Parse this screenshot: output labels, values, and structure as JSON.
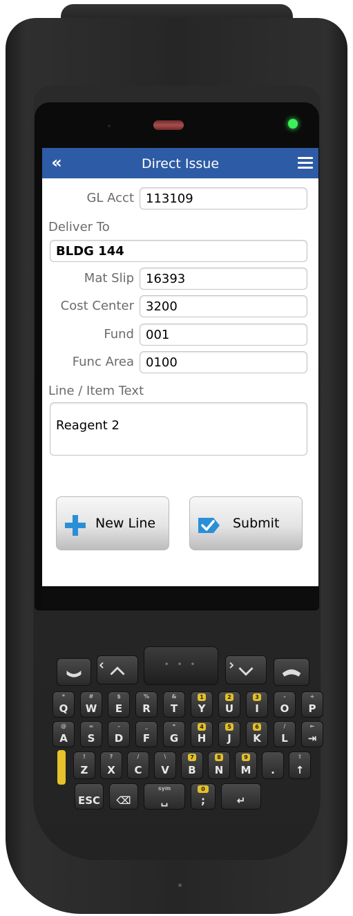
{
  "header": {
    "back_glyph": "«",
    "title": "Direct Issue"
  },
  "form": {
    "gl_acct": {
      "label": "GL Acct",
      "value": "113109"
    },
    "deliver_to": {
      "label": "Deliver To",
      "value": "BLDG 144"
    },
    "mat_slip": {
      "label": "Mat Slip",
      "value": "16393"
    },
    "cost_center": {
      "label": "Cost Center",
      "value": "3200"
    },
    "fund": {
      "label": "Fund",
      "value": "001"
    },
    "func_area": {
      "label": "Func Area",
      "value": "0100"
    },
    "line_item_text": {
      "label": "Line / Item Text",
      "value": "Reagent 2"
    }
  },
  "buttons": {
    "new_line": "New Line",
    "submit": "Submit"
  },
  "colors": {
    "navbar": "#2e5ba5",
    "icon_blue": "#2b8fd8",
    "led": "#3cf05a"
  },
  "keypad": {
    "row1": [
      {
        "main": "Q",
        "sub": "*"
      },
      {
        "main": "W",
        "sub": "#"
      },
      {
        "main": "E",
        "sub": "$"
      },
      {
        "main": "R",
        "sub": "%"
      },
      {
        "main": "T",
        "sub": "&"
      },
      {
        "main": "Y",
        "sub": "1"
      },
      {
        "main": "U",
        "sub": "2"
      },
      {
        "main": "I",
        "sub": "3"
      },
      {
        "main": "O",
        "sub": "-"
      },
      {
        "main": "P",
        "sub": "+"
      }
    ],
    "row2": [
      {
        "main": "A",
        "sub": "@"
      },
      {
        "main": "S",
        "sub": "="
      },
      {
        "main": "D",
        "sub": "-"
      },
      {
        "main": "F",
        "sub": "_"
      },
      {
        "main": "G",
        "sub": "*"
      },
      {
        "main": "H",
        "sub": "4"
      },
      {
        "main": "J",
        "sub": "5"
      },
      {
        "main": "K",
        "sub": "6"
      },
      {
        "main": "L",
        "sub": "/"
      },
      {
        "main": "⇥",
        "sub": "⇤"
      }
    ],
    "row3": [
      {
        "main": "Z",
        "sub": "!"
      },
      {
        "main": "X",
        "sub": "?"
      },
      {
        "main": "C",
        "sub": "/"
      },
      {
        "main": "V",
        "sub": "\\"
      },
      {
        "main": "B",
        "sub": "7"
      },
      {
        "main": "N",
        "sub": "8"
      },
      {
        "main": "M",
        "sub": "9"
      },
      {
        "main": ".",
        "sub": ""
      },
      {
        "main": "↑",
        "sub": "⇧"
      }
    ],
    "row4": [
      {
        "main": "ESC",
        "sub": ""
      },
      {
        "main": "⌫",
        "sub": ""
      },
      {
        "main": "␣",
        "sub": "sym"
      },
      {
        "main": ";",
        "sub": "0"
      },
      {
        "main": "↵",
        "sub": ""
      }
    ]
  }
}
